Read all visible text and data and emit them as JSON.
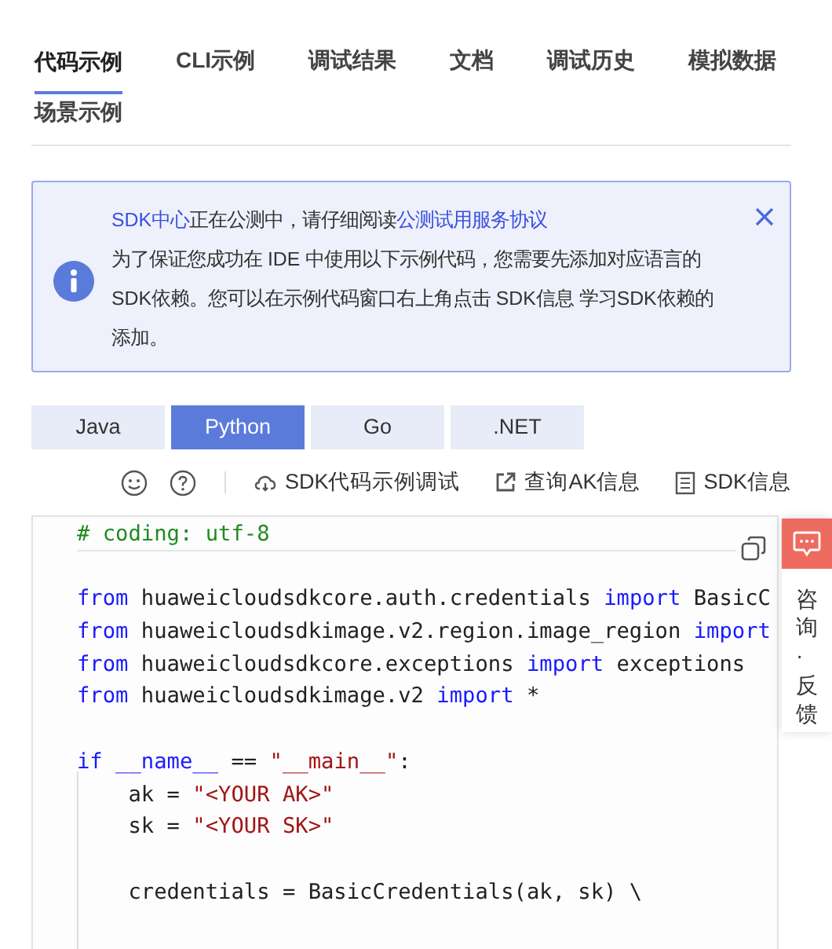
{
  "tabs": [
    {
      "label": "代码示例",
      "selected": true
    },
    {
      "label": "CLI示例",
      "selected": false
    },
    {
      "label": "调试结果",
      "selected": false
    },
    {
      "label": "文档",
      "selected": false
    },
    {
      "label": "调试历史",
      "selected": false
    },
    {
      "label": "模拟数据",
      "selected": false
    },
    {
      "label": "场景示例",
      "selected": false
    }
  ],
  "notice": {
    "title_parts": [
      {
        "kind": "link",
        "text": "SDK中心"
      },
      {
        "kind": "text",
        "text": "正在公测中，请仔细阅读"
      },
      {
        "kind": "link",
        "text": "公测试用服务协议"
      }
    ],
    "body": "为了保证您成功在 IDE 中使用以下示例代码，您需要先添加对应语言的SDK依赖。您可以在示例代码窗口右上角点击 SDK信息 学习SDK依赖的添加。"
  },
  "language_tabs": [
    {
      "label": "Java",
      "selected": false
    },
    {
      "label": "Python",
      "selected": true
    },
    {
      "label": "Go",
      "selected": false
    },
    {
      "label": ".NET",
      "selected": false
    }
  ],
  "toolbar_actions": [
    {
      "kind": "cloud",
      "label": "SDK代码示例调试"
    },
    {
      "kind": "share",
      "label": "查询AK信息"
    },
    {
      "kind": "doc",
      "label": "SDK信息"
    }
  ],
  "code_lines": [
    {
      "tokens": [
        {
          "kind": "comment",
          "text": "# coding: utf-8"
        }
      ]
    },
    {
      "gap_before": true,
      "tokens": [
        {
          "kind": "keyword",
          "text": "from"
        },
        {
          "kind": "plain",
          "text": " huaweicloudsdkcore.auth.credentials "
        },
        {
          "kind": "keyword",
          "text": "import"
        },
        {
          "kind": "plain",
          "text": " BasicC"
        }
      ]
    },
    {
      "tokens": [
        {
          "kind": "keyword",
          "text": "from"
        },
        {
          "kind": "plain",
          "text": " huaweicloudsdkimage.v2.region.image_region "
        },
        {
          "kind": "keyword",
          "text": "import"
        }
      ]
    },
    {
      "tokens": [
        {
          "kind": "keyword",
          "text": "from"
        },
        {
          "kind": "plain",
          "text": " huaweicloudsdkcore.exceptions "
        },
        {
          "kind": "keyword",
          "text": "import"
        },
        {
          "kind": "plain",
          "text": " exceptions"
        }
      ]
    },
    {
      "tokens": [
        {
          "kind": "keyword",
          "text": "from"
        },
        {
          "kind": "plain",
          "text": " huaweicloudsdkimage.v2 "
        },
        {
          "kind": "keyword",
          "text": "import"
        },
        {
          "kind": "plain",
          "text": " *"
        }
      ]
    },
    {
      "gap_before": true,
      "tokens": [
        {
          "kind": "keyword",
          "text": "if"
        },
        {
          "kind": "keyword",
          "text": " __name__"
        },
        {
          "kind": "plain",
          "text": " == "
        },
        {
          "kind": "string",
          "text": "\"__main__\""
        },
        {
          "kind": "plain",
          "text": ":"
        }
      ]
    },
    {
      "tokens": [
        {
          "kind": "plain",
          "text": "    ak = "
        },
        {
          "kind": "string",
          "text": "\"<YOUR AK>\""
        }
      ]
    },
    {
      "tokens": [
        {
          "kind": "plain",
          "text": "    sk = "
        },
        {
          "kind": "string",
          "text": "\"<YOUR SK>\""
        }
      ]
    },
    {
      "gap_before": true,
      "tokens": [
        {
          "kind": "plain",
          "text": "    credentials = BasicCredentials(ak, sk) \\"
        }
      ]
    }
  ],
  "feedback": {
    "label": "咨询·反馈"
  }
}
